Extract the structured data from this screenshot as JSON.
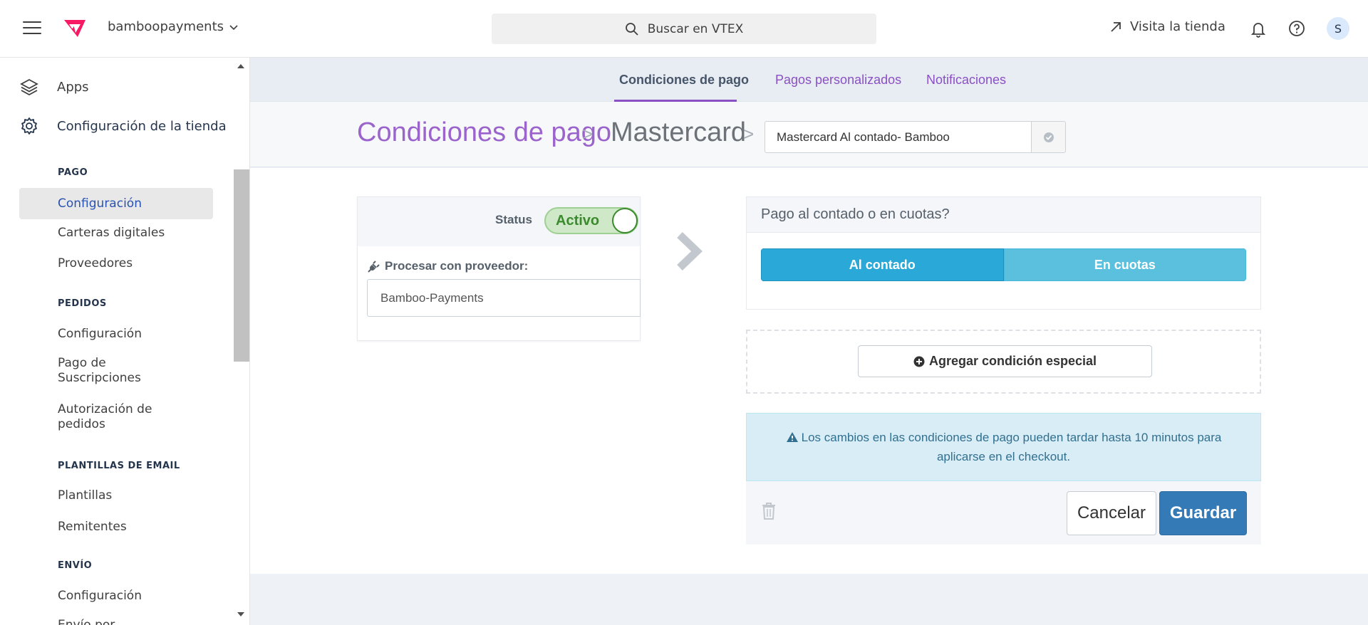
{
  "topbar": {
    "store_name": "bamboopayments",
    "search_placeholder": "Buscar en VTEX",
    "visit_store": "Visita la tienda",
    "avatar_initial": "S"
  },
  "sidebar": {
    "apps": "Apps",
    "store_config": "Configuración de la tienda",
    "groups": [
      {
        "title": "PAGO",
        "items": [
          "Configuración",
          "Carteras digitales",
          "Proveedores"
        ]
      },
      {
        "title": "PEDIDOS",
        "items": [
          "Configuración",
          "Pago de Suscripciones",
          "Autorización de pedidos"
        ]
      },
      {
        "title": "PLANTILLAS DE EMAIL",
        "items": [
          "Plantillas",
          "Remitentes"
        ]
      },
      {
        "title": "ENVÍO",
        "items": [
          "Configuración",
          "Envío por"
        ]
      }
    ],
    "active_item": "Configuración"
  },
  "tabs": [
    "Condiciones de pago",
    "Pagos personalizados",
    "Notificaciones"
  ],
  "breadcrumb": {
    "level1": "Condiciones de pago",
    "level2": "Mastercard",
    "separator": ">",
    "condition_name": "Mastercard Al contado- Bamboo"
  },
  "status_card": {
    "status_label": "Status",
    "status_value": "Activo",
    "processor_label": "Procesar con proveedor:",
    "processor_value": "Bamboo-Payments"
  },
  "payment_card": {
    "title": "Pago al contado o en cuotas?",
    "option_cash": "Al contado",
    "option_installments": "En cuotas"
  },
  "special_condition_button": "Agregar condición especial",
  "alert_text": "Los cambios en las condiciones de pago pueden tardar hasta 10 minutos para aplicarse en el checkout.",
  "actions": {
    "cancel": "Cancelar",
    "save": "Guardar"
  },
  "colors": {
    "accent_purple": "#8a50c4",
    "sidebar_active": "#2953b2",
    "status_green": "#3b8a2e",
    "segment_active": "#2aa8d8",
    "save_blue": "#337ab7"
  }
}
